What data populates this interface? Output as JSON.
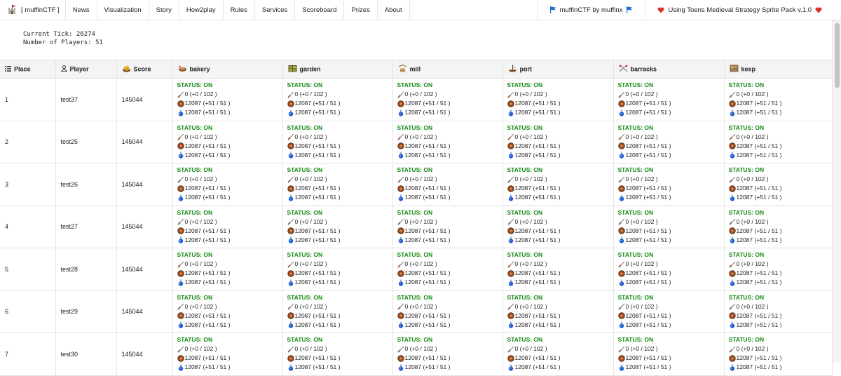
{
  "nav": {
    "brand": "[ muffinCTF ]",
    "items": [
      "News",
      "Visualization",
      "Story",
      "How2play",
      "Rules",
      "Services",
      "Scoreboard",
      "Prizes",
      "About"
    ],
    "right": [
      {
        "label": "muffinCTF by muffinx"
      },
      {
        "label": "Using Toens Medieval Strategy Sprite Pack v.1.0"
      }
    ]
  },
  "info": {
    "tick": "Current Tick: 26274",
    "players": "Number of Players: 51"
  },
  "table": {
    "headers": {
      "place": "Place",
      "player": "Player",
      "score": "Score",
      "services": [
        "bakery",
        "garden",
        "mill",
        "port",
        "barracks",
        "keep"
      ]
    },
    "rows": [
      {
        "place": "1",
        "player": "test37",
        "score": "145044"
      },
      {
        "place": "2",
        "player": "test25",
        "score": "145044"
      },
      {
        "place": "3",
        "player": "test26",
        "score": "145044"
      },
      {
        "place": "4",
        "player": "test27",
        "score": "145044"
      },
      {
        "place": "5",
        "player": "test28",
        "score": "145044"
      },
      {
        "place": "6",
        "player": "test29",
        "score": "145044"
      },
      {
        "place": "7",
        "player": "test30",
        "score": "145044"
      }
    ],
    "cell": {
      "status": "STATUS: ON",
      "attack": "0 (+0 / 102 )",
      "defense": "12087 (+51 / 51 )",
      "sla": "12087 (+51 / 51 )"
    }
  },
  "colors": {
    "status_on": "#138a13",
    "heart": "#d9342b",
    "flag": "#1f6fd1"
  }
}
